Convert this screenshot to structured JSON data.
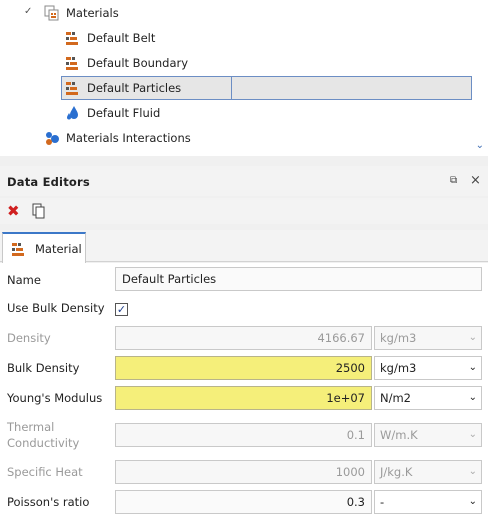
{
  "tree": {
    "materials_label": "Materials",
    "items": [
      {
        "label": "Default Belt"
      },
      {
        "label": "Default Boundary"
      },
      {
        "label": "Default Particles"
      },
      {
        "label": "Default Fluid"
      }
    ],
    "interactions_label": "Materials Interactions"
  },
  "data_editors": {
    "title": "Data Editors",
    "tab_label": "Material"
  },
  "properties": {
    "name": {
      "label": "Name",
      "value": "Default Particles"
    },
    "use_bulk_density": {
      "label": "Use Bulk Density",
      "checked": "✓"
    },
    "density": {
      "label": "Density",
      "value": "4166.67",
      "unit": "kg/m3"
    },
    "bulk_density": {
      "label": "Bulk Density",
      "value": "2500",
      "unit": "kg/m3"
    },
    "youngs_modulus": {
      "label": "Young's Modulus",
      "value": "1e+07",
      "unit": "N/m2"
    },
    "thermal_conductivity": {
      "label_line1": "Thermal",
      "label_line2": "Conductivity",
      "value": "0.1",
      "unit": "W/m.K"
    },
    "specific_heat": {
      "label": "Specific Heat",
      "value": "1000",
      "unit": "J/kg.K"
    },
    "poissons_ratio": {
      "label": "Poisson's ratio",
      "value": "0.3",
      "unit": "-"
    }
  },
  "colors": {
    "highlight": "#f5ef7a",
    "selection_border": "#6c8ec4",
    "delete_red": "#d02020",
    "tab_accent": "#3c78c8"
  }
}
